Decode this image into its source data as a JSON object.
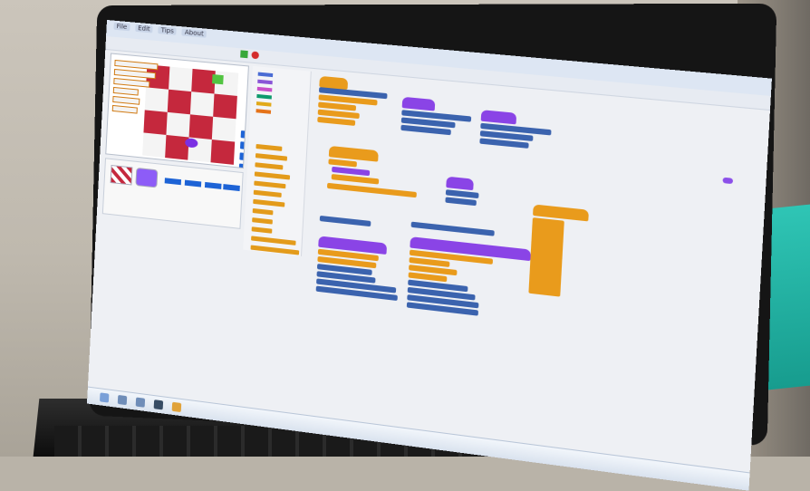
{
  "window": {
    "menu": [
      "File",
      "Edit",
      "Tips",
      "About"
    ]
  },
  "scratch_editor": {
    "zoom_controls": "- = +"
  },
  "colors": {
    "orange_block": "#e99b1c",
    "purple_block": "#8a44e6",
    "blue_block": "#3b63ae",
    "stage_red": "#c5283d"
  }
}
